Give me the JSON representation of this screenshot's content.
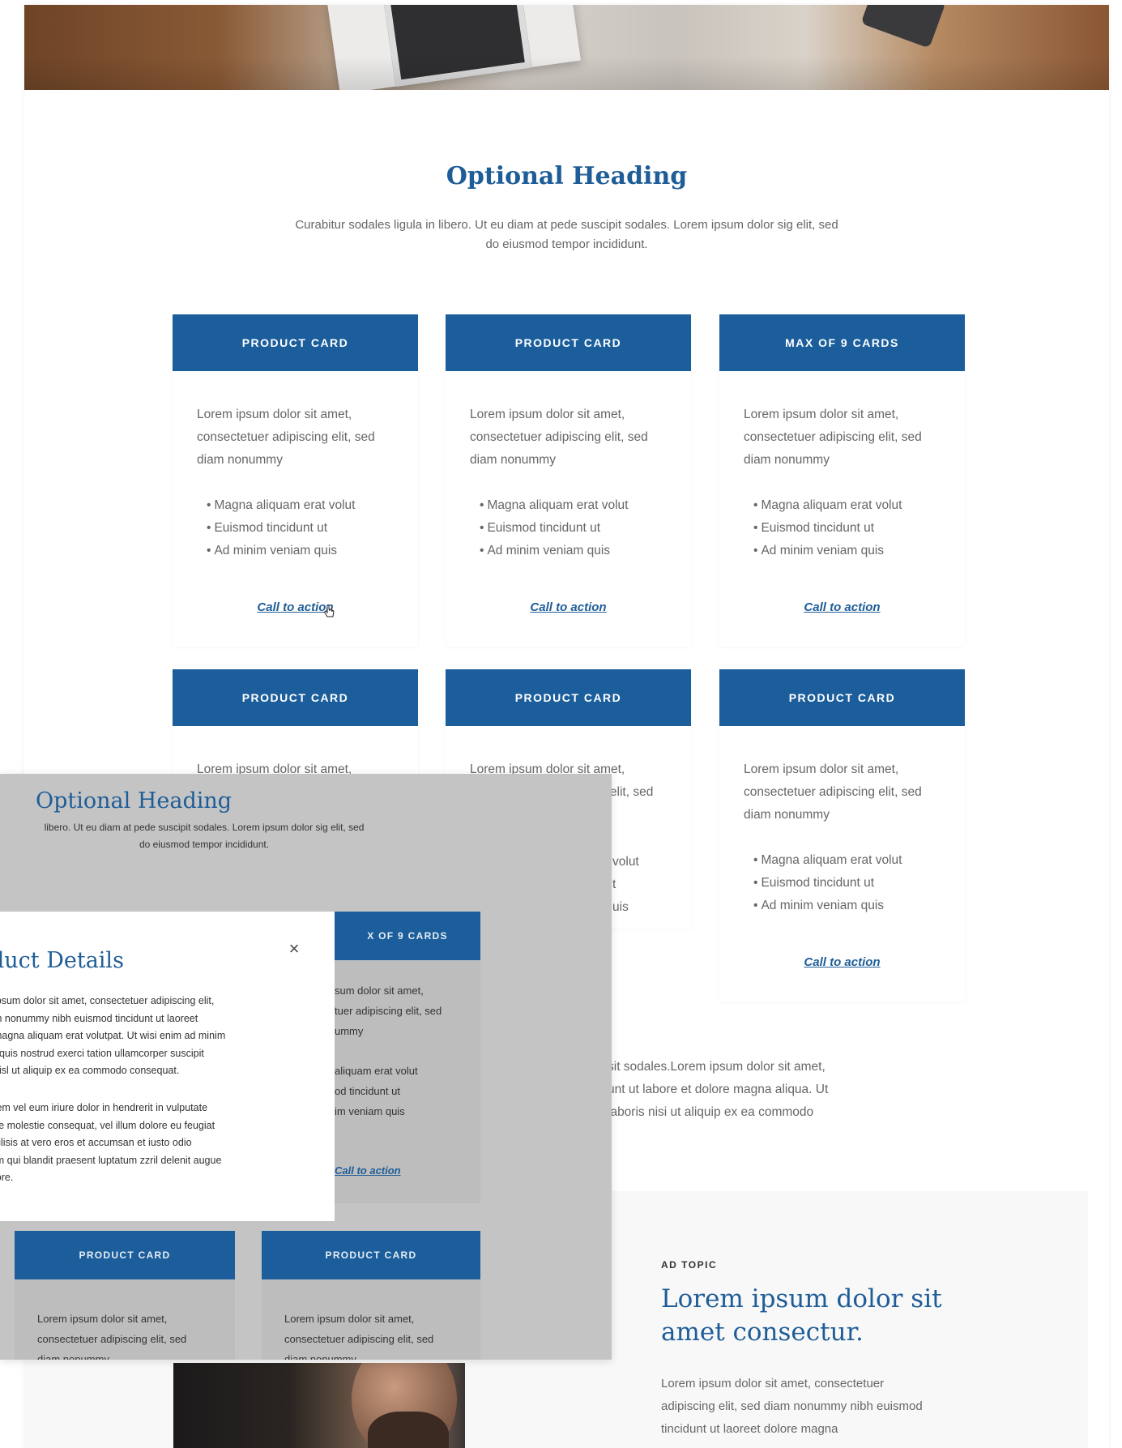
{
  "section": {
    "heading": "Optional Heading",
    "sub_line1": "Curabitur sodales ligula in libero. Ut eu diam at pede suscipit sodales. Lorem ipsum dolor sig elit, sed",
    "sub_line2": "do eiusmod tempor incididunt."
  },
  "cards": [
    {
      "header": "PRODUCT CARD",
      "text1": "Lorem ipsum dolor sit amet,",
      "text2": "consectetuer adipiscing elit, sed",
      "text3": "diam nonummy",
      "bullets": [
        "Magna aliquam erat volut",
        "Euismod tincidunt ut",
        "Ad minim veniam quis"
      ],
      "cta": "Call to action"
    },
    {
      "header": "PRODUCT CARD",
      "text1": "Lorem ipsum dolor sit amet,",
      "text2": "consectetuer adipiscing elit, sed",
      "text3": "diam nonummy",
      "bullets": [
        "Magna aliquam erat volut",
        "Euismod tincidunt ut",
        "Ad minim veniam quis"
      ],
      "cta": "Call to action"
    },
    {
      "header": "MAX OF 9 CARDS",
      "text1": "Lorem ipsum dolor sit amet,",
      "text2": "consectetuer adipiscing elit, sed",
      "text3": "diam nonummy",
      "bullets": [
        "Magna aliquam erat volut",
        "Euismod tincidunt ut",
        "Ad minim veniam quis"
      ],
      "cta": "Call to action"
    },
    {
      "header": "PRODUCT CARD",
      "text1": "Lorem ipsum dolor sit amet,"
    },
    {
      "header": "PRODUCT CARD",
      "text1": "Lorem ipsum dolor sit amet,",
      "text2_partial": "g elit, sed",
      "bullet1_partial": "volut",
      "bullet2_partial": "t",
      "bullet3_partial": "uis"
    },
    {
      "header": "PRODUCT CARD",
      "text1": "Lorem ipsum dolor sit amet,",
      "text2": "consectetuer adipiscing elit, sed",
      "text3": "diam nonummy",
      "bullets": [
        "Magna aliquam erat volut",
        "Euismod tincidunt ut",
        "Ad minim veniam quis"
      ],
      "cta": "Call to action"
    }
  ],
  "paragraph_right": {
    "line1": "sit sodales.Lorem ipsum dolor sit amet,",
    "line2": "unt ut labore et dolore magna aliqua. Ut",
    "line3": "laboris nisi ut aliquip ex ea commodo"
  },
  "ad": {
    "topic": "AD TOPIC",
    "title_line1": "Lorem ipsum dolor sit",
    "title_line2": "amet consectur.",
    "text_line1": "Lorem ipsum dolor sit amet, consectetuer",
    "text_line2": "adipiscing elit, sed diam nonummy nibh euismod",
    "text_line3": "tincidunt ut laoreet dolore magna"
  },
  "overlay": {
    "heading": "Optional Heading",
    "sub_line1": "libero. Ut eu diam at pede suscipit sodales. Lorem ipsum dolor sig elit, sed",
    "sub_line2": "do eiusmod tempor incididunt.",
    "card_max_header": "X OF 9 CARDS",
    "card_max_text1": "sum dolor sit amet,",
    "card_max_text2": "tuer adipiscing elit, sed",
    "card_max_text3": "ummy",
    "card_max_bullet1": "aliquam erat volut",
    "card_max_bullet2": "od tincidunt ut",
    "card_max_bullet3": "im veniam quis",
    "card_max_cta": "Call to action",
    "card_b1_header": "PRODUCT CARD",
    "card_b1_text1": "Lorem ipsum dolor sit amet,",
    "card_b1_text2": "consectetuer adipiscing elit, sed",
    "card_b1_text3": "diam nonummy",
    "card_b2_header": "PRODUCT CARD",
    "card_b2_text1": "Lorem ipsum dolor sit amet,",
    "card_b2_text2": "consectetuer adipiscing elit, sed",
    "card_b2_text3": "diam nonummy"
  },
  "modal": {
    "title": "duct Details",
    "close": "×",
    "p1_line1": "ipsum dolor sit amet, consectetuer adipiscing elit,",
    "p1_line2": "m nonummy nibh euismod tincidunt ut laoreet",
    "p1_line3": "magna aliquam erat volutpat. Ut wisi enim ad minim",
    "p1_line4": ", quis nostrud exerci tation ullamcorper suscipit",
    "p1_line5": "nisl ut aliquip ex ea commodo consequat.",
    "p2_line1": "tem vel eum iriure dolor in hendrerit in vulputate",
    "p2_line2": "se molestie consequat, vel illum dolore eu feugiat",
    "p2_line3": "cilisis at vero eros et accumsan et iusto odio",
    "p2_line4": "im qui blandit praesent luptatum zzril delenit augue",
    "p2_line5": "lore."
  },
  "colors": {
    "brand_blue": "#1b5e9b",
    "heading_blue": "#1e5d97",
    "overlay_grey": "#c4c4c4"
  },
  "icons": {
    "close": "close-icon",
    "cursor": "hand-pointer-icon"
  }
}
